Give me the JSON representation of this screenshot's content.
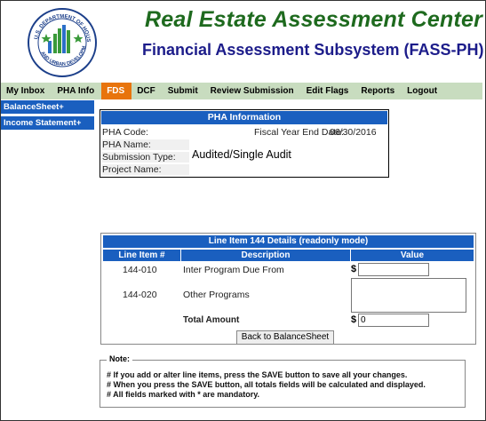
{
  "header": {
    "title": "Real Estate Assessment Center",
    "subtitle": "Financial Assessment Subsystem (FASS-PH)",
    "seal_text": "U.S. DEPARTMENT OF HOUSING AND URBAN DEVELOPMENT"
  },
  "nav": {
    "items": [
      "My Inbox",
      "PHA Info",
      "FDS",
      "DCF",
      "Submit",
      "Review Submission",
      "Edit Flags",
      "Reports",
      "Logout"
    ],
    "active": "FDS",
    "colors": {
      "bar": "#c8dcbf",
      "active": "#e8740c"
    }
  },
  "sidebar": {
    "items": [
      "BalanceSheet+",
      "Income Statement+"
    ]
  },
  "pha_info": {
    "title": "PHA Information",
    "pha_code_label": "PHA Code:",
    "fiscal_year_end_label": "Fiscal Year End Date:",
    "fiscal_year_end_value": "06/30/2016",
    "pha_name_label": "PHA Name:",
    "submission_type_label": "Submission Type:",
    "submission_type_value": "Audited/Single Audit",
    "project_name_label": "Project Name:"
  },
  "line_item": {
    "title": "Line Item 144 Details (readonly mode)",
    "columns": [
      "Line Item #",
      "Description",
      "Value"
    ],
    "rows": [
      {
        "number": "144-010",
        "description": "Inter Program Due From",
        "currency": "$",
        "value": ""
      },
      {
        "number": "144-020",
        "description": "Other Programs",
        "value": ""
      }
    ],
    "total_label": "Total Amount",
    "total_currency": "$",
    "total_value": "0",
    "back_button": "Back to BalanceSheet"
  },
  "note": {
    "title": "Note:",
    "lines": [
      "# If you add or alter line items, press the SAVE button to save all your changes.",
      "# When you press the SAVE button, all totals fields will be calculated and displayed.",
      "# All fields marked with * are mandatory."
    ]
  },
  "colors": {
    "accent_blue": "#1a5fbf",
    "title_green": "#1e6a1e",
    "subtitle_navy": "#1c1c8a"
  }
}
